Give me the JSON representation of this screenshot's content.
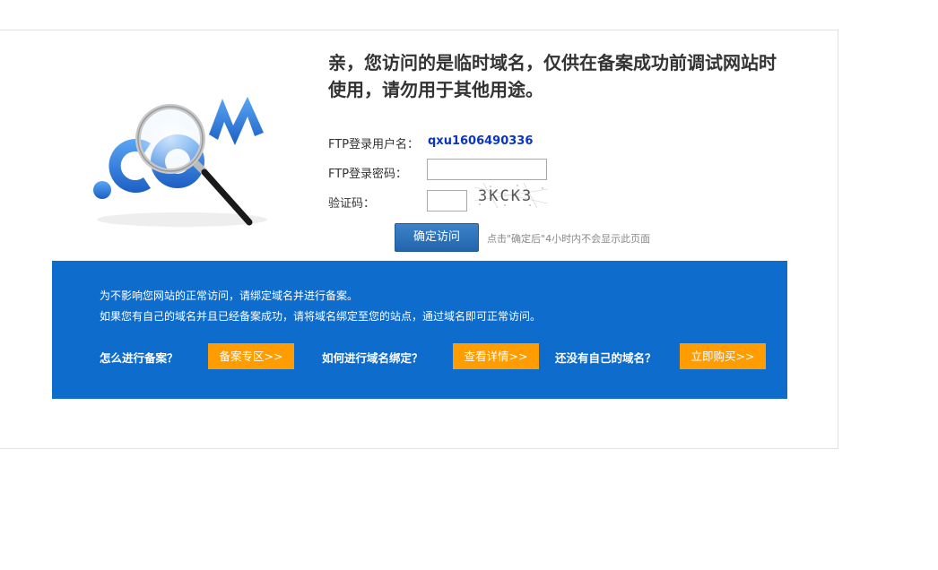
{
  "logo": {
    "text": ".COM",
    "icon": "magnifier-icon",
    "colors": {
      "letters": "#2f7ee2",
      "handle": "#222222"
    }
  },
  "headline": "亲，您访问的是临时域名，仅供在备案成功前调试网站时使用，请勿用于其他用途。",
  "form": {
    "username_label": "FTP登录用户名：",
    "username_value": "qxu1606490336",
    "password_label": "FTP登录密码：",
    "password_value": "",
    "captcha_label": "验证码：",
    "captcha_value": "",
    "captcha_text": "3KCK3",
    "confirm_label": "确定访问",
    "confirm_hint": "点击\"确定后\"4小时内不会显示此页面"
  },
  "panel": {
    "notice_1": "为不影响您网站的正常访问，请绑定域名并进行备案。",
    "notice_2": "如果您有自己的域名并且已经备案成功，请将域名绑定至您的站点，通过域名即可正常访问。",
    "q1": "怎么进行备案？",
    "btn1": "备案专区>>",
    "q2": "如何进行域名绑定？",
    "btn2": "查看详情>>",
    "q3": "还没有自己的域名？",
    "btn3": "立即购买>>",
    "colors": {
      "panel": "#0e6ccc",
      "button": "#ff9c00"
    }
  }
}
